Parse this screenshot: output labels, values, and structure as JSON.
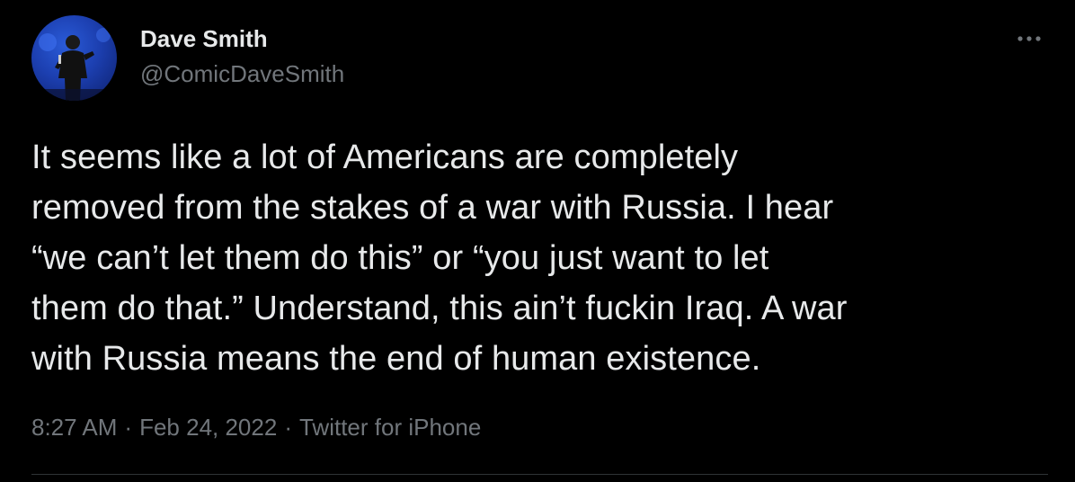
{
  "tweet": {
    "author": {
      "display_name": "Dave Smith",
      "handle": "@ComicDaveSmith"
    },
    "text": "It seems like a lot of Americans are completely\nremoved from the stakes of a war with Russia. I hear\n“we can’t let them do this” or “you just want to let\nthem do that.” Understand, this ain’t fuckin Iraq. A war\nwith Russia means the end of human existence.",
    "time": "8:27 AM",
    "separator": "·",
    "date": "Feb 24, 2022",
    "source": "Twitter for iPhone",
    "icons": {
      "more": "more-horizontal-icon"
    }
  },
  "colors": {
    "background": "#000000",
    "primary_text": "#e7e9ea",
    "secondary_text": "#71767b",
    "divider": "#2f3336"
  }
}
